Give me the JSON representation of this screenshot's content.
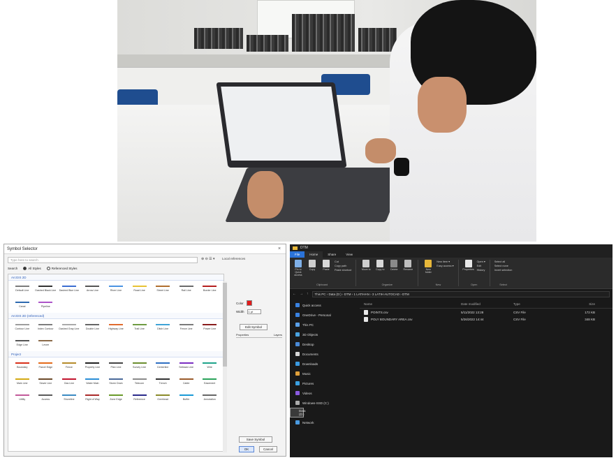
{
  "dialog": {
    "title": "Symbol Selector",
    "close": "×",
    "search_placeholder": "Type here to search",
    "search_icons": "⊕ ⊖ ☰ ▾",
    "top_right": "Local references",
    "filter_label": "Search",
    "filter_all": "All Styles",
    "filter_referenced": "Referenced Styles",
    "sections": [
      {
        "header": "ArcGIS 2D",
        "items": [
          {
            "label": "Default Line",
            "color": "#7b7b7b"
          },
          {
            "label": "Dashed Black Line",
            "color": "#333333"
          },
          {
            "label": "Dashed Blue Line",
            "color": "#3b6dd1"
          },
          {
            "label": "Arrow Line",
            "color": "#555555"
          },
          {
            "label": "River Line",
            "color": "#4b93e2"
          },
          {
            "label": "Road Line",
            "color": "#e7c334"
          },
          {
            "label": "Street Line",
            "color": "#b06f2e"
          },
          {
            "label": "Rail Line",
            "color": "#6a6a6a"
          },
          {
            "label": "Border Line",
            "color": "#b51f1f"
          },
          {
            "label": "Canal",
            "color": "#2d6ab0"
          },
          {
            "label": "Pipeline",
            "color": "#ad55c9"
          }
        ]
      },
      {
        "header": "ArcGIS 2D (referenced)",
        "items": [
          {
            "label": "Contour Line",
            "color": "#9d9d9d"
          },
          {
            "label": "Index Contour",
            "color": "#7d7d7d"
          },
          {
            "label": "Dashed Gray Line",
            "color": "#aaaaaa"
          },
          {
            "label": "Double Line",
            "color": "#666666"
          },
          {
            "label": "Highway Line",
            "color": "#e06b2e"
          },
          {
            "label": "Trail Line",
            "color": "#6f9b42"
          },
          {
            "label": "Ditch Line",
            "color": "#3ea3d6"
          },
          {
            "label": "Fence Line",
            "color": "#7a7a7a"
          },
          {
            "label": "Power Line",
            "color": "#8a1d1d"
          },
          {
            "label": "Edge Line",
            "color": "#555555"
          },
          {
            "label": "Levee",
            "color": "#8a6a4a"
          }
        ]
      },
      {
        "header": "Project",
        "items": [
          {
            "label": "Boundary",
            "color": "#d9311a"
          },
          {
            "label": "Parcel Edge",
            "color": "#e46b1a"
          },
          {
            "label": "Fence",
            "color": "#b58b2b"
          },
          {
            "label": "Property Line",
            "color": "#222222"
          },
          {
            "label": "Plan Line",
            "color": "#444444"
          },
          {
            "label": "Survey Line",
            "color": "#6b8e2f"
          },
          {
            "label": "Centerline",
            "color": "#2e6fc2"
          },
          {
            "label": "Setback Line",
            "color": "#7a2ec2"
          },
          {
            "label": "Wire",
            "color": "#1ea38a"
          },
          {
            "label": "Main Line",
            "color": "#d4aa14"
          },
          {
            "label": "Sewer Line",
            "color": "#6c4a2a"
          },
          {
            "label": "Gas Line",
            "color": "#c2142e"
          },
          {
            "label": "Water Main",
            "color": "#2a8ed6"
          },
          {
            "label": "Storm Drain",
            "color": "#4a6a9a"
          },
          {
            "label": "Telecom",
            "color": "#8a8a8a"
          },
          {
            "label": "Trench",
            "color": "#333333"
          },
          {
            "label": "Cable",
            "color": "#9a5a2a"
          },
          {
            "label": "Easement",
            "color": "#2aa35a"
          },
          {
            "label": "Utility",
            "color": "#c25a9a"
          },
          {
            "label": "Access",
            "color": "#5a5a5a"
          },
          {
            "label": "Shoreline",
            "color": "#3a8ac2"
          },
          {
            "label": "Right of Way",
            "color": "#aa2a2a"
          },
          {
            "label": "Zone Edge",
            "color": "#6a9a2a"
          },
          {
            "label": "Reference",
            "color": "#2a2a8a"
          },
          {
            "label": "Overhead",
            "color": "#8a8a2a"
          },
          {
            "label": "Buffer",
            "color": "#1a9ad6"
          },
          {
            "label": "Annotation",
            "color": "#666666"
          }
        ]
      }
    ],
    "color_label": "Color",
    "color_value": "#e21b1b",
    "width_label": "Width",
    "width_value": "1 pt",
    "edit_button": "Edit Symbol",
    "tab_general": "Properties",
    "tab_layers": "Layers",
    "save_button": "Save Symbol",
    "ok": "OK",
    "cancel": "Cancel"
  },
  "explorer": {
    "title": "DTM",
    "tabs": [
      "File",
      "Home",
      "Share",
      "View"
    ],
    "ribbon": {
      "clipboard": [
        "Pin to Quick access",
        "Copy",
        "Paste"
      ],
      "clipboard_small": [
        "Cut",
        "Copy path",
        "Paste shortcut"
      ],
      "clipboard_caption": "Clipboard",
      "organize": [
        "Move to",
        "Copy to",
        "Delete",
        "Rename"
      ],
      "organize_caption": "Organize",
      "new": [
        "New folder"
      ],
      "new_small": [
        "New item ▾",
        "Easy access ▾"
      ],
      "new_caption": "New",
      "open": [
        "Properties"
      ],
      "open_small": [
        "Open ▾",
        "Edit",
        "History"
      ],
      "open_caption": "Open",
      "select_small": [
        "Select all",
        "Select none",
        "Invert selection"
      ],
      "select_caption": "Select"
    },
    "address": "This PC  ›  Data (D:)  ›  DTM  ›  1 LATIHAN  ›  3 LATIH AUTOCAD  ›  DTM",
    "columns": {
      "name": "Name",
      "date": "Date modified",
      "type": "Type",
      "size": "Size"
    },
    "files": [
      {
        "name": "POINTS.csv",
        "date": "5/11/2022 13:28",
        "type": "CSV File",
        "size": "172 KB"
      },
      {
        "name": "POLY BOUNDARY AREA.csv",
        "date": "5/26/2022 14:44",
        "type": "CSV File",
        "size": "348 KB"
      }
    ],
    "nav": [
      {
        "label": "Quick access",
        "color": "#3a82e0"
      },
      {
        "label": "OneDrive - Personal",
        "color": "#3a82e0"
      },
      {
        "label": "This PC",
        "color": "#5aa0e8"
      },
      {
        "label": "3D Objects",
        "color": "#4aa3e0"
      },
      {
        "label": "Desktop",
        "color": "#4a8ad6"
      },
      {
        "label": "Documents",
        "color": "#d6d6d6"
      },
      {
        "label": "Downloads",
        "color": "#3a9ae0"
      },
      {
        "label": "Music",
        "color": "#e0a03a"
      },
      {
        "label": "Pictures",
        "color": "#3aa0e0"
      },
      {
        "label": "Videos",
        "color": "#8a5ae0"
      },
      {
        "label": "Windows-SSD (C:)",
        "color": "#aaaaaa"
      },
      {
        "label": "Data (D:)",
        "color": "#aaaaaa"
      },
      {
        "label": "Network",
        "color": "#4a9ae0"
      }
    ]
  }
}
